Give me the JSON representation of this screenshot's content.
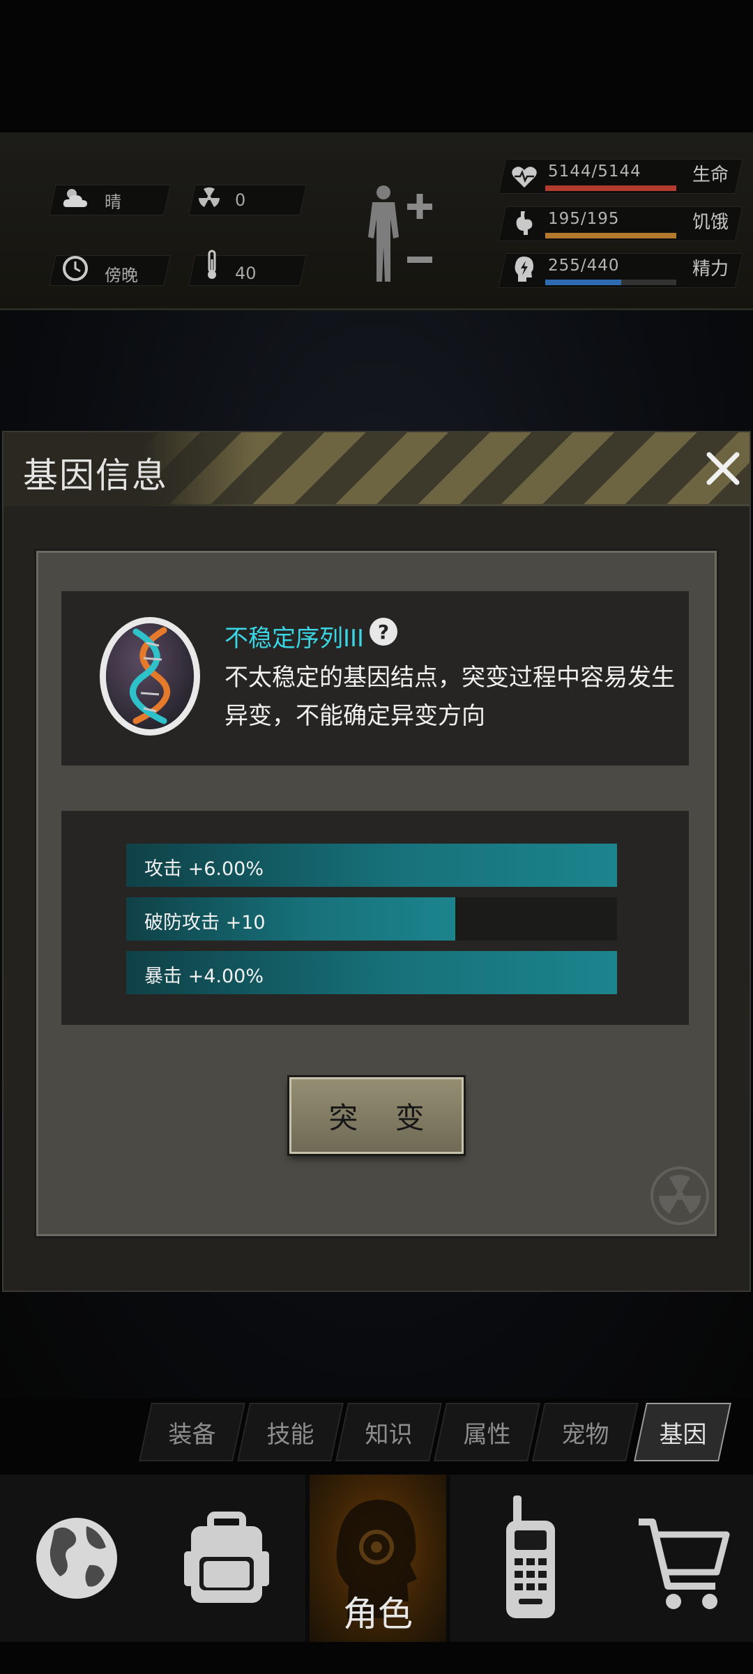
{
  "hud": {
    "weather": {
      "icon": "cloud-sun-icon",
      "label": "晴"
    },
    "radiation": {
      "icon": "radiation-icon",
      "value": "0"
    },
    "time": {
      "icon": "clock-icon",
      "label": "傍晚"
    },
    "temperature": {
      "icon": "thermometer-icon",
      "value": "40"
    },
    "stats": [
      {
        "name": "生命",
        "value": "5144/5144",
        "icon": "heart-pulse-icon",
        "fraction": 1.0,
        "color": "#b23a2e"
      },
      {
        "name": "饥饿",
        "value": "195/195",
        "icon": "stomach-icon",
        "fraction": 1.0,
        "color": "#b2782e"
      },
      {
        "name": "精力",
        "value": "255/440",
        "icon": "energy-head-icon",
        "fraction": 0.58,
        "color": "#2e6bb2"
      }
    ]
  },
  "modal": {
    "title": "基因信息",
    "gene": {
      "name": "不稳定序列III",
      "description": "不太稳定的基因结点，突变过程中容易发生异变，不能确定异变方向"
    },
    "attributes": [
      {
        "label": "攻击 +6.00%",
        "fraction": 1.0
      },
      {
        "label": "破防攻击 +10",
        "fraction": 0.67
      },
      {
        "label": "暴击 +4.00%",
        "fraction": 1.0
      }
    ],
    "mutate_label": "突 变"
  },
  "subtabs": [
    {
      "label": "装备",
      "active": false
    },
    {
      "label": "技能",
      "active": false
    },
    {
      "label": "知识",
      "active": false
    },
    {
      "label": "属性",
      "active": false
    },
    {
      "label": "宠物",
      "active": false
    },
    {
      "label": "基因",
      "active": true
    }
  ],
  "bottom_nav": [
    {
      "icon": "globe-icon",
      "active": false
    },
    {
      "icon": "backpack-icon",
      "active": false
    },
    {
      "icon": "character-head-icon",
      "label": "角色",
      "active": true
    },
    {
      "icon": "walkie-talkie-icon",
      "active": false
    },
    {
      "icon": "shopping-cart-icon",
      "active": false
    }
  ],
  "colors": {
    "accent_cyan": "#3ad6e4",
    "attribute_bar": "#1c848d",
    "hazard_yellow": "#6d6441"
  }
}
